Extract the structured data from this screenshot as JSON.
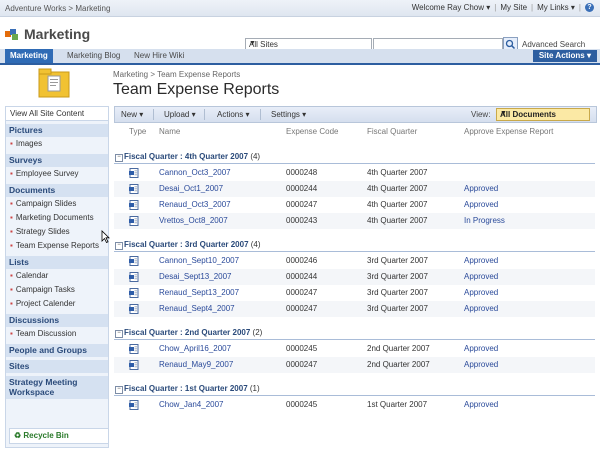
{
  "topbar": {
    "breadcrumb": "Adventure Works > Marketing",
    "welcome": "Welcome Ray Chow",
    "my_site": "My Site",
    "my_links": "My Links"
  },
  "header": {
    "site_title": "Marketing",
    "scope": "All Sites",
    "search_value": "",
    "advanced_search": "Advanced Search"
  },
  "nav": {
    "tabs": [
      "Marketing",
      "Marketing Blog",
      "New Hire Wiki"
    ],
    "site_actions": "Site Actions"
  },
  "page": {
    "breadcrumb": "Marketing > Team Expense Reports",
    "title": "Team Expense Reports"
  },
  "leftnav": {
    "view_all": "View All Site Content",
    "sections": [
      {
        "title": "Pictures",
        "items": [
          "Images"
        ]
      },
      {
        "title": "Surveys",
        "items": [
          "Employee Survey"
        ]
      },
      {
        "title": "Documents",
        "items": [
          "Campaign Slides",
          "Marketing Documents",
          "Strategy Slides",
          "Team Expense Reports"
        ]
      },
      {
        "title": "Lists",
        "items": [
          "Calendar",
          "Campaign Tasks",
          "Project Calender"
        ]
      },
      {
        "title": "Discussions",
        "items": [
          "Team Discussion"
        ]
      },
      {
        "title": "People and Groups",
        "items": []
      },
      {
        "title": "Sites",
        "items": []
      },
      {
        "title": "Strategy Meeting Workspace",
        "items": []
      }
    ],
    "recycle_bin": "Recycle Bin"
  },
  "toolbar": {
    "new": "New",
    "upload": "Upload",
    "actions": "Actions",
    "settings": "Settings",
    "view_label": "View:",
    "view_value": "All Documents"
  },
  "columns": {
    "type": "Type",
    "name": "Name",
    "code": "Expense Code",
    "quarter": "Fiscal Quarter",
    "approve": "Approve Expense Report"
  },
  "groups": [
    {
      "label": "Fiscal Quarter",
      "value": ": 4th Quarter 2007",
      "count": "(4)",
      "rows": [
        {
          "name": "Cannon_Oct3_2007",
          "code": "0000248",
          "quarter": "4th Quarter 2007",
          "approve": ""
        },
        {
          "name": "Desai_Oct1_2007",
          "code": "0000244",
          "quarter": "4th Quarter 2007",
          "approve": "Approved"
        },
        {
          "name": "Renaud_Oct3_2007",
          "code": "0000247",
          "quarter": "4th Quarter 2007",
          "approve": "Approved"
        },
        {
          "name": "Vrettos_Oct8_2007",
          "code": "0000243",
          "quarter": "4th Quarter 2007",
          "approve": "In Progress"
        }
      ]
    },
    {
      "label": "Fiscal Quarter",
      "value": ": 3rd Quarter 2007",
      "count": "(4)",
      "rows": [
        {
          "name": "Cannon_Sept10_2007",
          "code": "0000246",
          "quarter": "3rd Quarter 2007",
          "approve": "Approved"
        },
        {
          "name": "Desai_Sept13_2007",
          "code": "0000244",
          "quarter": "3rd Quarter 2007",
          "approve": "Approved"
        },
        {
          "name": "Renaud_Sept13_2007",
          "code": "0000247",
          "quarter": "3rd Quarter 2007",
          "approve": "Approved"
        },
        {
          "name": "Renaud_Sept4_2007",
          "code": "0000247",
          "quarter": "3rd Quarter 2007",
          "approve": "Approved"
        }
      ]
    },
    {
      "label": "Fiscal Quarter",
      "value": ": 2nd Quarter 2007",
      "count": "(2)",
      "rows": [
        {
          "name": "Chow_April16_2007",
          "code": "0000245",
          "quarter": "2nd Quarter 2007",
          "approve": "Approved"
        },
        {
          "name": "Renaud_May9_2007",
          "code": "0000247",
          "quarter": "2nd Quarter 2007",
          "approve": "Approved"
        }
      ]
    },
    {
      "label": "Fiscal Quarter",
      "value": ": 1st Quarter 2007",
      "count": "(1)",
      "rows": [
        {
          "name": "Chow_Jan4_2007",
          "code": "0000245",
          "quarter": "1st Quarter 2007",
          "approve": "Approved"
        }
      ]
    }
  ]
}
